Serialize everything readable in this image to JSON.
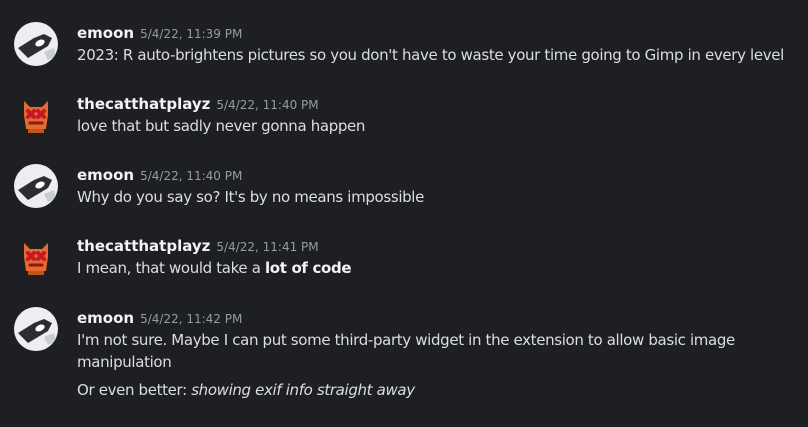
{
  "messages": [
    {
      "author": "emoon",
      "avatar_icon": "emoon-avatar-icon",
      "timestamp": "5/4/22, 11:39 PM",
      "lines": [
        {
          "text": "2023: R auto-brightens pictures so you don't have to waste your time going to Gimp in every level"
        }
      ]
    },
    {
      "author": "thecatthatplayz",
      "avatar_icon": "red-angry-cat-avatar-icon",
      "timestamp": "5/4/22, 11:40 PM",
      "lines": [
        {
          "text": "love that but sadly never gonna happen"
        }
      ]
    },
    {
      "author": "emoon",
      "avatar_icon": "emoon-avatar-icon",
      "timestamp": "5/4/22, 11:40 PM",
      "lines": [
        {
          "text": "Why do you say so? It's by no means impossible"
        }
      ]
    },
    {
      "author": "thecatthatplayz",
      "avatar_icon": "red-angry-cat-avatar-icon",
      "timestamp": "5/4/22, 11:41 PM",
      "lines": [
        {
          "prefix": "I mean, that would take a ",
          "bold": "lot of code"
        }
      ]
    },
    {
      "author": "emoon",
      "avatar_icon": "emoon-avatar-icon",
      "timestamp": "5/4/22, 11:42 PM",
      "lines": [
        {
          "text": "I'm not sure. Maybe I can put some third-party widget in the extension to allow basic image manipulation"
        },
        {
          "prefix": "Or even better: ",
          "italic": "showing exif info straight away"
        }
      ]
    }
  ],
  "colors": {
    "background": "#1e1f22",
    "text": "#dbdee1",
    "author": "#f2f3f5",
    "timestamp": "#949ba4"
  }
}
